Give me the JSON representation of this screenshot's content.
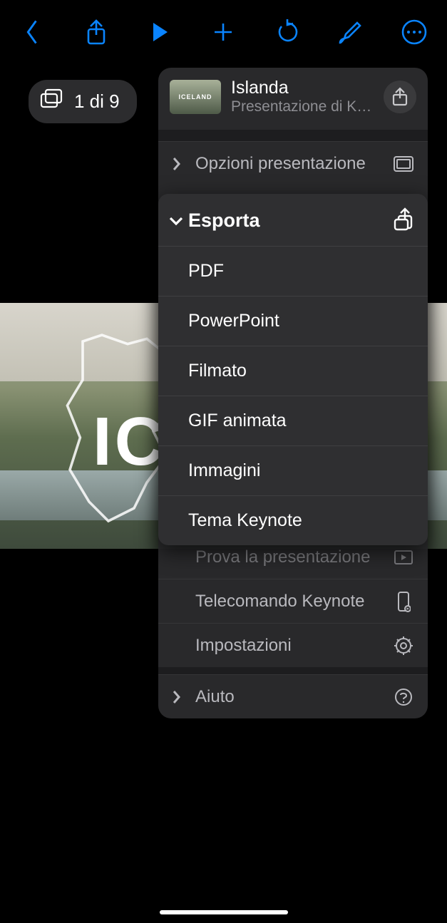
{
  "toolbar": {
    "back": "Indietro",
    "share": "Condividi",
    "play": "Riproduci",
    "add": "Aggiungi",
    "undo": "Annulla",
    "format": "Formatta",
    "more": "Altro"
  },
  "slide_counter": "1 di 9",
  "slide_title_fragment": "IC",
  "popover": {
    "doc_title": "Islanda",
    "doc_subtitle": "Presentazione di K…",
    "rows": {
      "presentation_options": "Opzioni presentazione",
      "rehearse": "Prova la presentazione",
      "remote": "Telecomando Keynote",
      "settings": "Impostazioni",
      "help": "Aiuto"
    }
  },
  "export": {
    "title": "Esporta",
    "items": [
      "PDF",
      "PowerPoint",
      "Filmato",
      "GIF animata",
      "Immagini",
      "Tema Keynote"
    ]
  }
}
